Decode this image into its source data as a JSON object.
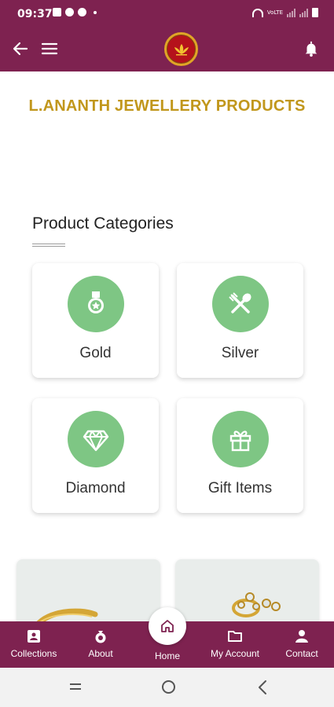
{
  "status_bar": {
    "time": "09:37",
    "network": "VoLTE"
  },
  "app_bar": {
    "logo_icon": "lotus-logo-icon"
  },
  "header": {
    "company_name": "L.ANANTH JEWELLERY PRODUCTS"
  },
  "categories_section": {
    "title": "Product Categories",
    "items": [
      {
        "label": "Gold",
        "icon": "medal-icon"
      },
      {
        "label": "Silver",
        "icon": "spoon-fork-icon"
      },
      {
        "label": "Diamond",
        "icon": "diamond-icon"
      },
      {
        "label": "Gift Items",
        "icon": "gift-icon"
      }
    ]
  },
  "bottom_nav": {
    "items": [
      {
        "label": "Collections",
        "icon": "collections-icon"
      },
      {
        "label": "About",
        "icon": "about-icon"
      },
      {
        "label": "Home",
        "icon": "home-icon"
      },
      {
        "label": "My Account",
        "icon": "folder-icon"
      },
      {
        "label": "Contact",
        "icon": "person-icon"
      }
    ]
  },
  "colors": {
    "brand": "#7e2250",
    "title_gold": "#c1971c",
    "category_green": "#7ec684"
  }
}
